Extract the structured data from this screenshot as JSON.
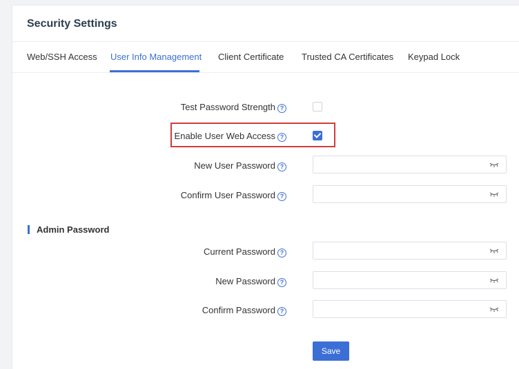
{
  "header": {
    "title": "Security Settings"
  },
  "tabs": [
    {
      "label": "Web/SSH Access"
    },
    {
      "label": "User Info Management",
      "active": true
    },
    {
      "label": "Client Certificate"
    },
    {
      "label": "Trusted CA Certificates"
    },
    {
      "label": "Keypad Lock"
    }
  ],
  "user_section": {
    "test_password_strength": {
      "label": "Test Password Strength",
      "checked": false
    },
    "enable_user_web_access": {
      "label": "Enable User Web Access",
      "checked": true
    },
    "new_user_password": {
      "label": "New User Password",
      "value": ""
    },
    "confirm_user_password": {
      "label": "Confirm User Password",
      "value": ""
    }
  },
  "admin_section": {
    "title": "Admin Password",
    "current_password": {
      "label": "Current Password",
      "value": ""
    },
    "new_password": {
      "label": "New Password",
      "value": ""
    },
    "confirm_password": {
      "label": "Confirm Password",
      "value": ""
    }
  },
  "actions": {
    "save_label": "Save"
  },
  "icons": {
    "help": "question-circle-icon",
    "visibility": "eye-closed-icon"
  },
  "colors": {
    "accent": "#3c6fd6",
    "highlight_border": "#d43a3a"
  }
}
